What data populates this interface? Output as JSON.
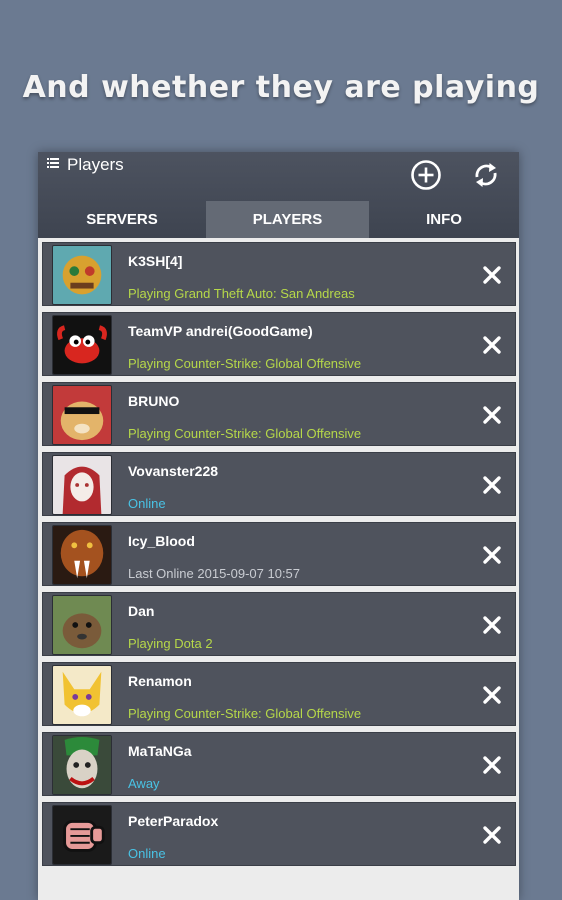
{
  "headline": "And whether they are playing",
  "appbar": {
    "title": "Players",
    "menu_icon": "list-icon",
    "add_icon": "add-circle-icon",
    "refresh_icon": "refresh-icon"
  },
  "tabs": [
    {
      "label": "SERVERS",
      "active": false
    },
    {
      "label": "PLAYERS",
      "active": true
    },
    {
      "label": "INFO",
      "active": false
    }
  ],
  "colors": {
    "playing": "#b6d849",
    "online": "#49c2e4",
    "last_online": "#c9ccd2",
    "row_bg": "#4f535d"
  },
  "players": [
    {
      "name": "K3SH[4]",
      "status": "Playing Grand Theft Auto: San Andreas",
      "state": "playing"
    },
    {
      "name": "TeamVP andrei(GoodGame)",
      "status": "Playing Counter-Strike: Global Offensive",
      "state": "playing"
    },
    {
      "name": "BRUNO",
      "status": "Playing Counter-Strike: Global Offensive",
      "state": "playing"
    },
    {
      "name": "Vovanster228",
      "status": "Online",
      "state": "online"
    },
    {
      "name": "Icy_Blood",
      "status": "Last Online 2015-09-07 10:57",
      "state": "last"
    },
    {
      "name": "Dan",
      "status": "Playing Dota 2",
      "state": "playing"
    },
    {
      "name": "Renamon",
      "status": "Playing Counter-Strike: Global Offensive",
      "state": "playing"
    },
    {
      "name": "MaTaNGa",
      "status": "Away",
      "state": "away"
    },
    {
      "name": "PeterParadox",
      "status": "Online",
      "state": "online"
    }
  ]
}
